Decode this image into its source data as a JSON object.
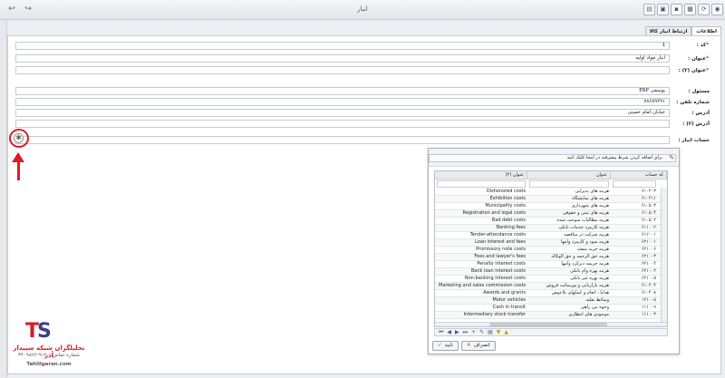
{
  "window": {
    "title": "انبار"
  },
  "tabs": [
    {
      "label": "اطلاعات"
    },
    {
      "label": "ارتباط انبار کالا"
    }
  ],
  "form": {
    "code_label": "کد :",
    "code_value": "1",
    "title_label": "عنوان :",
    "title_value": "انبار مواد اولیه",
    "title2_label": "عنوان (۲) :",
    "title2_value": "",
    "manager_label": "مسئول :",
    "manager_value": "ERP یوسفی",
    "phone_label": "شماره تلفن :",
    "phone_value": "۷۸۶۸۹۲۹۱",
    "address_label": "آدرس :",
    "address_value": "خیابان امام خمینی",
    "address2_label": "آدرس (۲) :",
    "address2_value": "",
    "inventory_label": "حساب انبار :"
  },
  "popup": {
    "hint": "برای اضافه کردن شرط پیشرفته در اینجا کلیک کنید",
    "columns": {
      "code": "کد حساب",
      "title": "عنوان",
      "title2": "عنوان (۲)"
    },
    "rows": [
      {
        "code": "۶۱۰۲۰۳",
        "title": "هزینه های پذیرایی",
        "title2": "Dishonored costs"
      },
      {
        "code": "۶۱۰۴۱۱",
        "title": "هزینه های نمایشگاه",
        "title2": "Exhibition costs"
      },
      {
        "code": "۶۱۰۵۰۳",
        "title": "هزینه های شهرداری",
        "title2": "Municipality costs"
      },
      {
        "code": "۶۱۰۵۰۴",
        "title": "هزینه های ثبتی و حقوقی",
        "title2": "Registration and legal costs"
      },
      {
        "code": "۶۱۰۵۰۲",
        "title": "هزینه مطالبات سوخت شده",
        "title2": "Bad debt costs"
      },
      {
        "code": "۶۱۱۰۰۲",
        "title": "هزینه کارمزد خدمات بانکی",
        "title2": "Banking fees"
      },
      {
        "code": "۶۱۲۰۰۱",
        "title": "هزینه شرکت در مناقصه",
        "title2": "Tender-attendance costs"
      },
      {
        "code": "۶۲۱۰۰۱",
        "title": "هزینه سود و کارمزد وامها",
        "title2": "Loan interest and fees"
      },
      {
        "code": "۶۲۱۰۰۶",
        "title": "هزینه خرید سفته",
        "title2": "Promissory note costs"
      },
      {
        "code": "۶۲۱۰۰۳",
        "title": "هزینه حق الزحمه و حق الوکاله",
        "title2": "Fees and lawyer's fees"
      },
      {
        "code": "۶۲۱۰۰۴",
        "title": "هزینه جریمه دیرکرد وامها",
        "title2": "Penalty interest costs"
      },
      {
        "code": "۶۲۱۰۰۲",
        "title": "هزینه بهره وام بانکی",
        "title2": "Bank loan interest costs"
      },
      {
        "code": "۶۲۱۰۰۵",
        "title": "هزینه بهره غیر بانکی",
        "title2": "Non-banking interest costs"
      },
      {
        "code": "۶۱۰۴۰۴",
        "title": "هزینه بازاریابی و پورسانت فروش",
        "title2": "Marketing and sales commission costs"
      },
      {
        "code": "۶۱۰۴۰۸",
        "title": "هدایا ، انعام و کمکهای بلاعوض",
        "title2": "Awards and grants"
      },
      {
        "code": "۱۲۱۰۰۵",
        "title": "وسائط نقلیه",
        "title2": "Motor vehicles"
      },
      {
        "code": "۱۱۱۰۰۹",
        "title": "وجوه بین راهی",
        "title2": "Cash in transit"
      },
      {
        "code": "۱۱۱۰۰۳",
        "title": "موجودی های انتظاری",
        "title2": "Intermediary stock transfer"
      }
    ],
    "ok_label": "تایید",
    "cancel_label": "انصراف"
  },
  "logo": {
    "name": "تحلیلگران شبکه سپیدار آذر",
    "phone": "شماره تماس: ۹۱۲۰-۳۴۰۹۸۶۲",
    "url": "Tahlilgaran.com"
  },
  "colors": {
    "accent": "#3a5a88",
    "required": "#d21f1f",
    "annotation": "#e11b22"
  }
}
